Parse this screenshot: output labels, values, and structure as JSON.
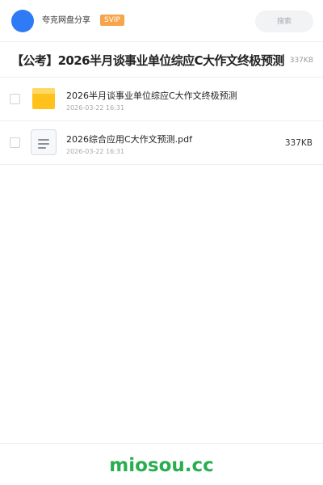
{
  "header": {
    "app_name": "夸克网盘分享",
    "badge": "SVIP",
    "search_placeholder": "搜索",
    "accent": "#2f7bf5",
    "badge_color": "#f7a54a"
  },
  "share": {
    "title": "【公考】2026半月谈事业单位综应C大作文终极预测",
    "total_size": "337KB"
  },
  "files": [
    {
      "name": "2026半月谈事业单位综应C大作文终极预测",
      "date": "2026-03-22 16:31",
      "size": "",
      "icon": "folder-icon"
    },
    {
      "name": "2026综合应用C大作文预测.pdf",
      "date": "2026-03-22 16:31",
      "size": "337KB",
      "icon": "document-icon"
    }
  ],
  "footer": {
    "brand": "miosou.cc",
    "brand_color": "#27ae4f"
  }
}
